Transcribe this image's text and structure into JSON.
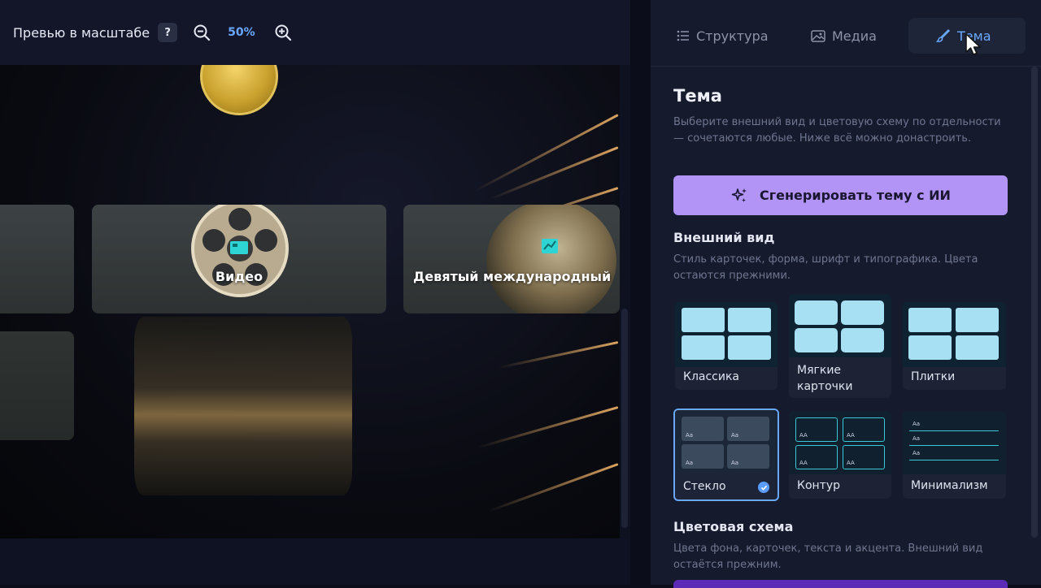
{
  "preview": {
    "zoom_label": "Превью в масштабе",
    "help": "?",
    "zoom_value": "50%",
    "cards": [
      {
        "title": "Видео"
      },
      {
        "title": "Девятый международный"
      }
    ]
  },
  "panel": {
    "tabs": [
      {
        "label": "Структура",
        "icon": "list-icon"
      },
      {
        "label": "Медиа",
        "icon": "image-icon"
      },
      {
        "label": "Тема",
        "icon": "brush-icon",
        "active": true
      }
    ],
    "title": "Тема",
    "description": "Выберите внешний вид и цветовую схему по отдельности — сочетаются любые. Ниже всё можно донастроить.",
    "ai_button": "Сгенерировать тему с ИИ",
    "appearance": {
      "title": "Внешний вид",
      "description": "Стиль карточек, форма, шрифт и типографика. Цвета остаются прежними.",
      "styles": [
        {
          "label": "Классика"
        },
        {
          "label": "Мягкие карточки"
        },
        {
          "label": "Плитки"
        },
        {
          "label": "Стекло",
          "selected": true
        },
        {
          "label": "Контур"
        },
        {
          "label": "Минимализм"
        }
      ]
    },
    "colors": {
      "title": "Цветовая схема",
      "description": "Цвета фона, карточек, текста и акцента. Внешний вид остаётся прежним."
    }
  },
  "colors": {
    "accent": "#6aa8ff",
    "ai_button": "#b194f5",
    "panel_bg": "#151a2c"
  }
}
